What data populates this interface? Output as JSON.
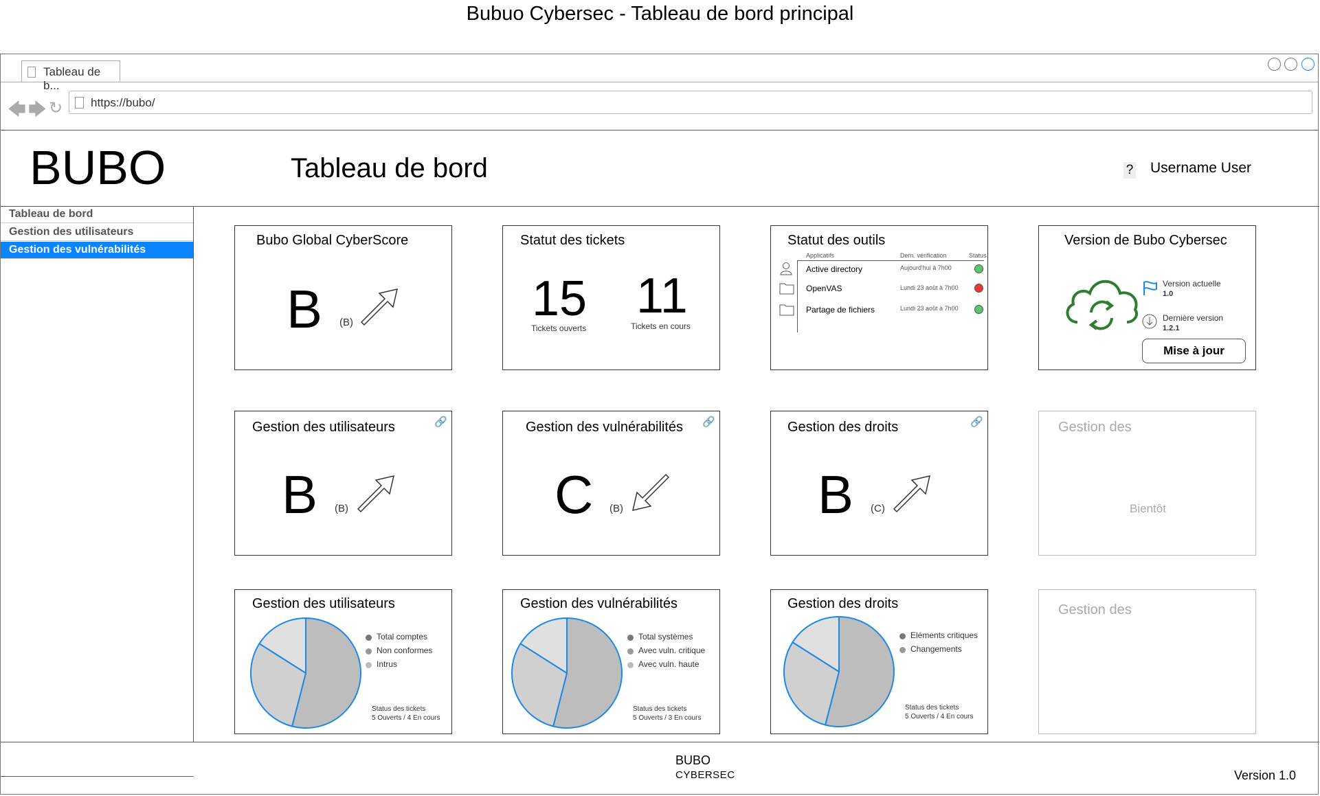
{
  "page_title": "Bubuo Cybersec - Tableau de bord principal",
  "browser": {
    "tab_label": "Tableau de b...",
    "url": "https://bubo/"
  },
  "header": {
    "logo": "BUBO",
    "title": "Tableau de bord",
    "help": "?",
    "user": "Username User"
  },
  "sidebar": {
    "items": [
      {
        "label": "Tableau de bord"
      },
      {
        "label": "Gestion des utilisateurs"
      },
      {
        "label": "Gestion des vulnérabilités"
      }
    ]
  },
  "cards": {
    "cyberscore": {
      "title": "Bubo Global CyberScore",
      "grade": "B",
      "previous": "(B)",
      "trend": "up"
    },
    "tickets": {
      "title": "Statut des tickets",
      "open_count": "15",
      "open_label": "Tickets ouverts",
      "inprogress_count": "11",
      "inprogress_label": "Tickets en cours"
    },
    "tools": {
      "title": "Statut des outils",
      "headers": [
        "Applicatifs",
        "Dern. vérification",
        "Status"
      ],
      "rows": [
        {
          "icon": "user-icon",
          "name": "Active directory",
          "checked": "Aujourd'hui à 7h00",
          "status": "ok",
          "color": "#5cc46b"
        },
        {
          "icon": "folder-icon",
          "name": "OpenVAS",
          "checked": "Lundi 23 août à 7h00",
          "status": "error",
          "color": "#e53935"
        },
        {
          "icon": "folder-icon",
          "name": "Partage de fichiers",
          "checked": "Lundi 23 août à 7h00",
          "status": "ok",
          "color": "#5cc46b"
        }
      ]
    },
    "version": {
      "title": "Version de Bubo Cybersec",
      "current_label": "Version actuelle",
      "current_value": "1.0",
      "latest_label": "Dernière version",
      "latest_value": "1.2.1",
      "update_button": "Mise à jour",
      "cloud_color": "#2e7d32"
    },
    "users_score": {
      "title": "Gestion des utilisateurs",
      "grade": "B",
      "previous": "(B)",
      "trend": "up"
    },
    "vulns_score": {
      "title": "Gestion des vulnérabilités",
      "grade": "C",
      "previous": "(B)",
      "trend": "down"
    },
    "rights_score": {
      "title": "Gestion des droits",
      "grade": "B",
      "previous": "(C)",
      "trend": "up"
    },
    "soon": {
      "title": "Gestion des",
      "text": "Bientôt"
    },
    "users_pie": {
      "title": "Gestion des utilisateurs",
      "legend": [
        "Total comptes",
        "Non conformes",
        "Intrus"
      ],
      "status_label": "Status des tickets",
      "status_value": "5 Ouverts / 4 En cours"
    },
    "vulns_pie": {
      "title": "Gestion des vulnérabilités",
      "legend": [
        "Total systèmes",
        "Avec vuln. critique",
        "Avec vuln. haute"
      ],
      "status_label": "Status des tickets",
      "status_value": "5 Ouverts / 3 En cours"
    },
    "rights_pie": {
      "title": "Gestion des droits",
      "legend": [
        "Eléments critiques",
        "Changements"
      ],
      "status_label": "Status des tickets",
      "status_value": "5 Ouverts / 4 En cours"
    },
    "soon2": {
      "title": "Gestion des"
    }
  },
  "pie_colors": [
    "#bdbdbd",
    "#d0d0d0",
    "#e0e0e0"
  ],
  "pie_stroke": "#1e88e5",
  "legend_colors": [
    "#777777",
    "#999999",
    "#bbbbbb"
  ],
  "accent": "#0a84ff",
  "footer": {
    "logo_top": "BUBO",
    "logo_bottom": "CYBERSEC",
    "version": "Version 1.0"
  }
}
